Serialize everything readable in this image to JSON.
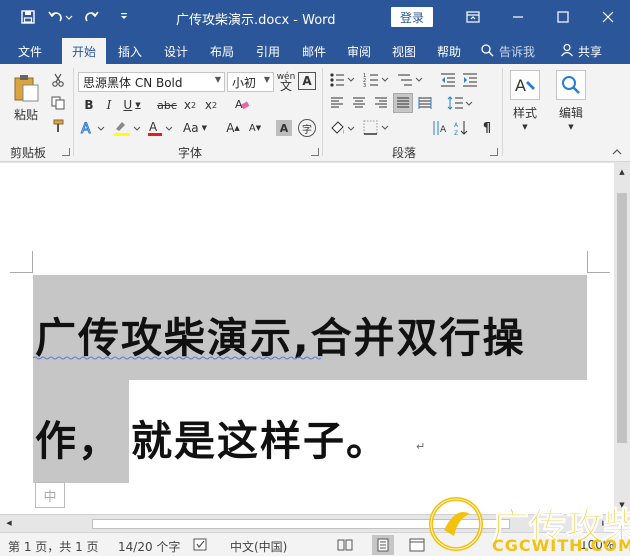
{
  "window": {
    "title": "广传攻柴演示.docx  -  Word",
    "login_label": "登录"
  },
  "tabs": [
    {
      "label": "文件"
    },
    {
      "label": "开始"
    },
    {
      "label": "插入"
    },
    {
      "label": "设计"
    },
    {
      "label": "布局"
    },
    {
      "label": "引用"
    },
    {
      "label": "邮件"
    },
    {
      "label": "审阅"
    },
    {
      "label": "视图"
    },
    {
      "label": "帮助"
    }
  ],
  "tell_me": "告诉我",
  "share": "共享",
  "ribbon": {
    "clipboard": {
      "paste_label": "粘贴",
      "group_label": "剪贴板"
    },
    "font": {
      "font_name": "思源黑体 CN Bold",
      "font_size": "小初",
      "group_label": "字体",
      "wen_glyph": "wén",
      "A_glyph": "A"
    },
    "paragraph": {
      "group_label": "段落"
    },
    "styles": {
      "label": "样式"
    },
    "editing": {
      "label": "编辑"
    }
  },
  "document": {
    "line1": "广传攻柴演示,合并双行操",
    "line2_selected": "作，",
    "line2_rest": "就是这样子。",
    "paragraph_mark": "↵",
    "ime_char": "中"
  },
  "status": {
    "page": "第 1 页，共 1 页",
    "words": "14/20 个字",
    "language": "中文(中国)",
    "zoom": "100%"
  },
  "watermark": {
    "text": "广传攻柴",
    "url": "CGCWITH.COM"
  },
  "colors": {
    "accent": "#2b579a",
    "ribbon_bg": "#f3f3f3",
    "selection": "#c6c6c6",
    "watermark": "#f3c20f"
  }
}
